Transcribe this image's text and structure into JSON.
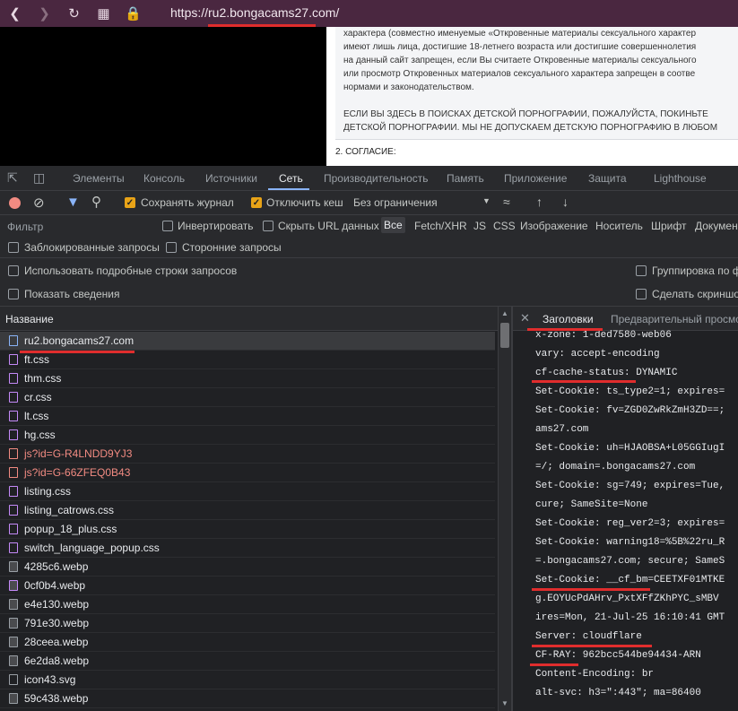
{
  "browser": {
    "url": "https://ru2.bongacams27.com/",
    "back_icon": "chevron-left-icon",
    "forward_icon": "chevron-right-icon",
    "reload_icon": "reload-icon",
    "apps_icon": "grid-icon",
    "lock_icon": "lock-icon"
  },
  "page": {
    "lines": [
      "характера (совместно именуемые «Откровенные материалы сексуального характер",
      "имеют лишь лица, достигшие 18-летнего возраста или достигшие совершеннолетия",
      "на данный сайт запрещен, если Вы считаете Откровенные материалы сексуального",
      "или просмотр Откровенных материалов сексуального характера запрещен в соотве",
      "нормами и законодательством.",
      "",
      "ЕСЛИ ВЫ ЗДЕСЬ В ПОИСКАХ ДЕТСКОЙ ПОРНОГРАФИИ, ПОЖАЛУЙСТА, ПОКИНЬТЕ",
      "ДЕТСКОЙ ПОРНОГРАФИИ. МЫ НЕ ДОПУСКАЕМ ДЕТСКУЮ ПОРНОГРАФИЮ В ЛЮБОМ"
    ],
    "agreement_heading": "2. СОГЛАСИЕ:"
  },
  "devtools": {
    "tabs": [
      "Элементы",
      "Консоль",
      "Источники",
      "Сеть",
      "Производительность",
      "Память",
      "Приложение",
      "Защита",
      "Lighthouse"
    ],
    "active_tab": "Сеть",
    "toolbar": {
      "preserve_log": "Сохранять журнал",
      "disable_cache": "Отключить кеш",
      "throttling": "Без ограничения"
    },
    "filter": {
      "placeholder": "Фильтр",
      "invert": "Инвертировать",
      "hide_data_urls": "Скрыть URL данных",
      "types": [
        "Все",
        "Fetch/XHR",
        "JS",
        "CSS",
        "Изображение",
        "Носитель",
        "Шрифт",
        "Докумен"
      ],
      "blocked_requests": "Заблокированные запросы",
      "third_party": "Сторонние запросы"
    },
    "options": {
      "big_rows": "Использовать подробные строки запросов",
      "overview": "Показать сведения",
      "group_by_frame": "Группировка по ф",
      "capture_screenshots": "Сделать скриншо"
    },
    "requests_header": "Название",
    "requests": [
      {
        "name": "ru2.bongacams27.com",
        "type": "doc"
      },
      {
        "name": "ft.css",
        "type": "css"
      },
      {
        "name": "thm.css",
        "type": "css"
      },
      {
        "name": "cr.css",
        "type": "css"
      },
      {
        "name": "lt.css",
        "type": "css"
      },
      {
        "name": "hg.css",
        "type": "css"
      },
      {
        "name": "js?id=G-R4LNDD9YJ3",
        "type": "err"
      },
      {
        "name": "js?id=G-66ZFEQ0B43",
        "type": "err"
      },
      {
        "name": "listing.css",
        "type": "css"
      },
      {
        "name": "listing_catrows.css",
        "type": "css"
      },
      {
        "name": "popup_18_plus.css",
        "type": "css"
      },
      {
        "name": "switch_language_popup.css",
        "type": "css"
      },
      {
        "name": "4285c6.webp",
        "type": "img"
      },
      {
        "name": "0cf0b4.webp",
        "type": "img2"
      },
      {
        "name": "e4e130.webp",
        "type": "img"
      },
      {
        "name": "791e30.webp",
        "type": "img"
      },
      {
        "name": "28ceea.webp",
        "type": "img"
      },
      {
        "name": "6e2da8.webp",
        "type": "img"
      },
      {
        "name": "icon43.svg",
        "type": "svg"
      },
      {
        "name": "59c438.webp",
        "type": "img"
      }
    ],
    "details": {
      "close_icon": "close-icon",
      "tabs": [
        "Заголовки",
        "Предварительный просмо"
      ],
      "active_tab": "Заголовки",
      "header_lines": [
        "x-zone: 1-ded7580-web06",
        "vary: accept-encoding",
        "cf-cache-status: DYNAMIC",
        "Set-Cookie: ts_type2=1; expires=",
        "Set-Cookie: fv=ZGD0ZwRkZmH3ZD==;",
        "ams27.com",
        "Set-Cookie: uh=HJAOBSA+L05GGIugI",
        "=/; domain=.bongacams27.com",
        "Set-Cookie: sg=749; expires=Tue,",
        "cure; SameSite=None",
        "Set-Cookie: reg_ver2=3; expires=",
        "Set-Cookie: warning18=%5B%22ru_R",
        "=.bongacams27.com; secure; SameS",
        "Set-Cookie: __cf_bm=CEETXF01MTKE",
        "g.EOYUcPdAHrv_PxtXFfZKhPYC_sMBV",
        "ires=Mon, 21-Jul-25 16:10:41 GMT",
        "Server: cloudflare",
        "CF-RAY: 962bcc544be94434-ARN",
        "Content-Encoding: br",
        "alt-svc: h3=\":443\"; ma=86400"
      ]
    }
  }
}
